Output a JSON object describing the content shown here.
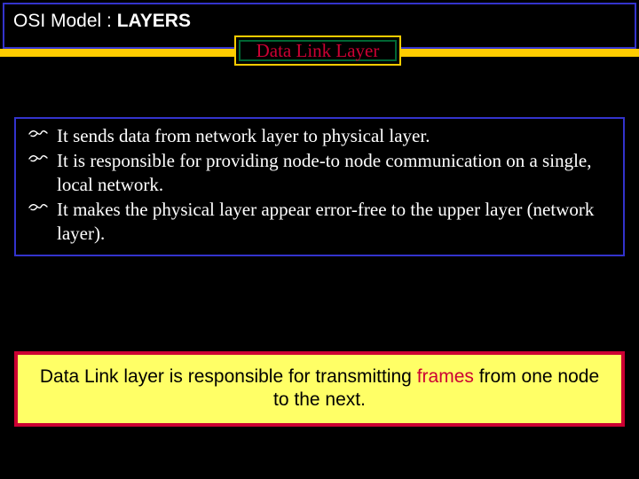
{
  "header": {
    "title_plain": "OSI Model : ",
    "title_bold": "LAYERS"
  },
  "subtitle": "Data Link Layer",
  "bullets": [
    "It sends data from network layer to physical layer.",
    "It is responsible for providing node-to node communication on a single, local network.",
    "It makes the physical layer appear error-free to the upper layer (network layer)."
  ],
  "summary": {
    "prefix": "Data Link layer is responsible for transmitting ",
    "highlight": "frames",
    "suffix": " from one node to the next."
  },
  "colors": {
    "accent_yellow": "#ffcc00",
    "accent_red": "#cc0033",
    "border_blue": "#3333cc",
    "summary_bg": "#ffff66"
  }
}
